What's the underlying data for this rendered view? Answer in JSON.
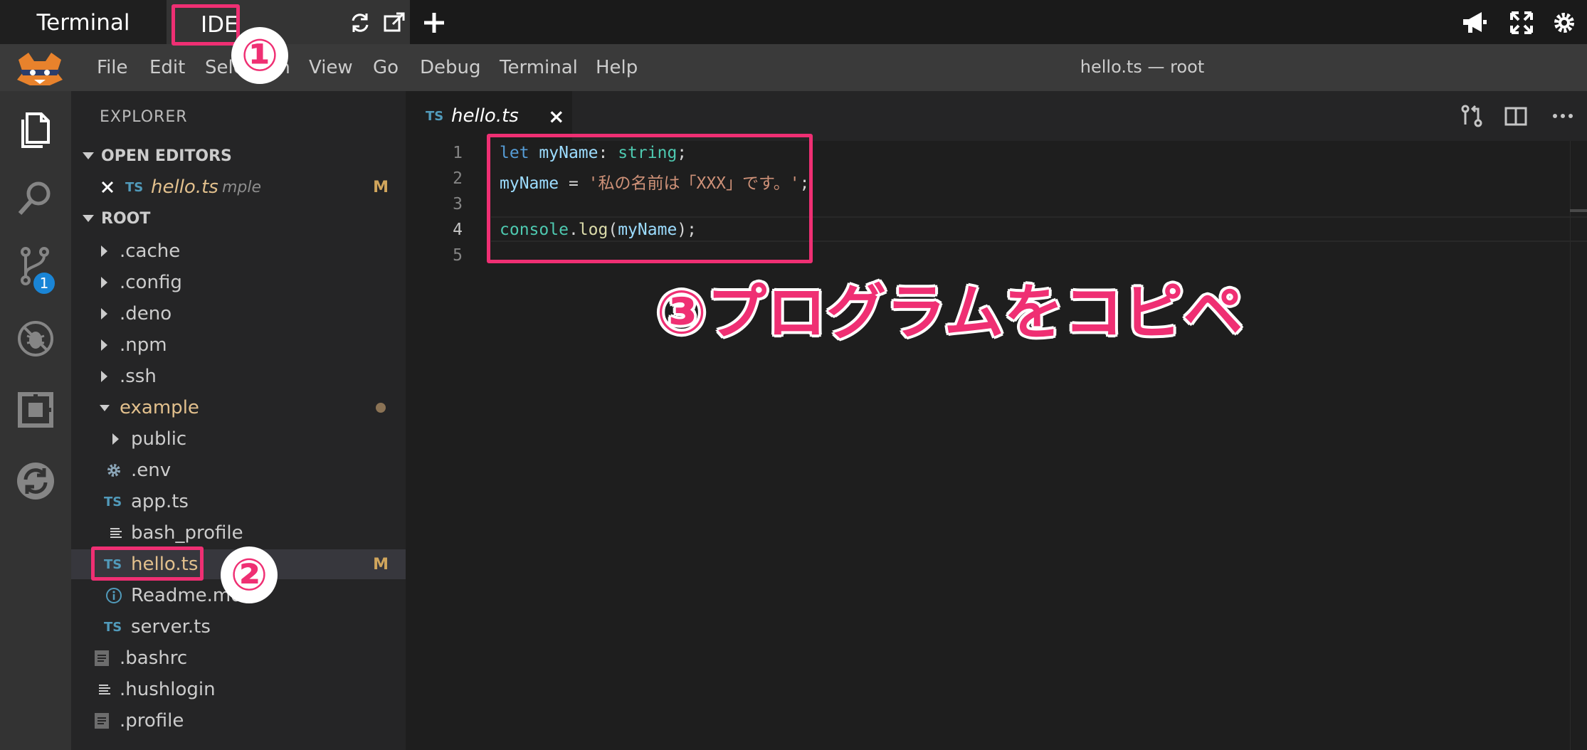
{
  "top_tabs": {
    "terminal": "Terminal",
    "ide": "IDE"
  },
  "menu": [
    "File",
    "Edit",
    "Selection",
    "View",
    "Go",
    "Debug",
    "Terminal",
    "Help"
  ],
  "window_title": "hello.ts — root",
  "activity": {
    "scm_badge": "1"
  },
  "explorer": {
    "title": "EXPLORER",
    "open_editors_label": "OPEN EDITORS",
    "open_editor": {
      "type_tag": "TS",
      "name": "hello.ts",
      "path": "mple",
      "status": "M"
    },
    "root_label": "ROOT",
    "tree": [
      {
        "name": ".cache"
      },
      {
        "name": ".config"
      },
      {
        "name": ".deno"
      },
      {
        "name": ".npm"
      },
      {
        "name": ".ssh"
      },
      {
        "name": "example"
      },
      {
        "name": "public"
      },
      {
        "name": ".env"
      },
      {
        "type_tag": "TS",
        "name": "app.ts"
      },
      {
        "name": "bash_profile"
      },
      {
        "type_tag": "TS",
        "name": "hello.ts",
        "status": "M"
      },
      {
        "name": "Readme.md"
      },
      {
        "type_tag": "TS",
        "name": "server.ts"
      },
      {
        "name": ".bashrc"
      },
      {
        "name": ".hushlogin"
      },
      {
        "name": ".profile"
      }
    ]
  },
  "editor": {
    "tab": {
      "type_tag": "TS",
      "name": "hello.ts",
      "close": "×"
    },
    "line_numbers": [
      "1",
      "2",
      "3",
      "4",
      "5"
    ],
    "code": {
      "l1": {
        "kw": "let",
        "var": "myName",
        "colon": ": ",
        "type": "string",
        "semi": ";"
      },
      "l2": {
        "var": "myName",
        "op": " = ",
        "str": "'私の名前は「XXX」です。'",
        "semi": ";"
      },
      "l4": {
        "obj": "console",
        "dot": ".",
        "fn": "log",
        "open": "(",
        "arg": "myName",
        "close": ");"
      }
    }
  },
  "annotations": {
    "badge1": "①",
    "badge2": "②",
    "callout": "③プログラムをコピペ",
    "color": "#ef2f73"
  }
}
